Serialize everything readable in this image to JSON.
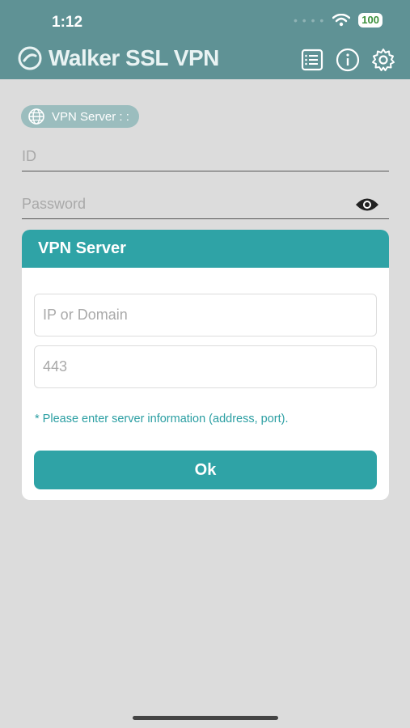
{
  "status_bar": {
    "time": "1:12",
    "battery": "100"
  },
  "header": {
    "brand": "Walker SSL VPN",
    "icons": [
      "list-icon",
      "info-icon",
      "gear-icon"
    ]
  },
  "server_chip": {
    "label": "VPN Server : :"
  },
  "login": {
    "id_placeholder": "ID",
    "password_placeholder": "Password"
  },
  "dialog": {
    "title": "VPN Server",
    "address_placeholder": "IP or Domain",
    "port_placeholder": "443",
    "hint": "* Please enter server information (address, port).",
    "ok_label": "Ok"
  },
  "colors": {
    "header": "#5f9295",
    "accent": "#2fa3a6",
    "background": "#dcdcdc"
  }
}
